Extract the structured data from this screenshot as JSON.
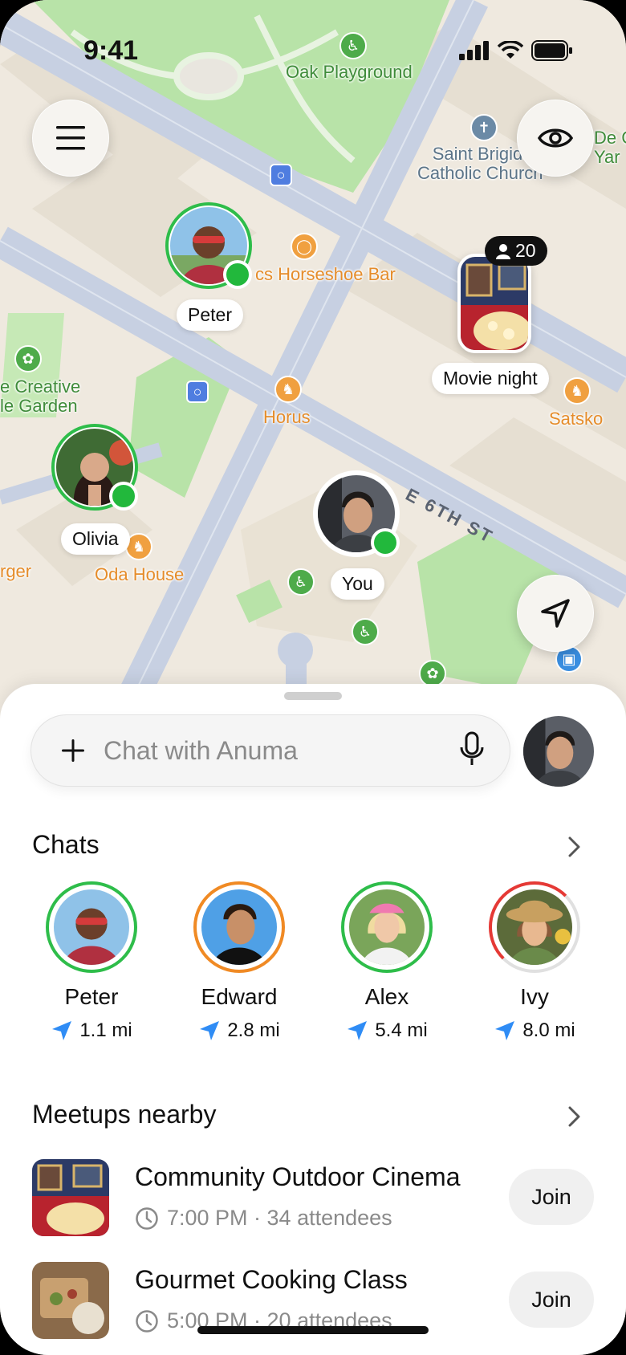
{
  "status": {
    "time": "9:41"
  },
  "map": {
    "labels": {
      "oak_playground": "Oak Playground",
      "church": "Saint Brigid\nCatholic Church",
      "de_co": "De C\nYar",
      "horseshoe": "cs Horseshoe Bar",
      "creative_garden": "e Creative\nle Garden",
      "horus": "Horus",
      "satsko": "Satsko",
      "oda_house": "Oda House",
      "burger": "rger",
      "street": "E 6TH ST"
    },
    "markers": {
      "peter": "Peter",
      "olivia": "Olivia",
      "you": "You",
      "movie_night": "Movie night",
      "movie_night_count": "20"
    }
  },
  "sheet": {
    "chat_placeholder": "Chat with Anuma",
    "chats_title": "Chats",
    "chats": [
      {
        "name": "Peter",
        "distance": "1.1 mi",
        "ring": "#2ebd4a"
      },
      {
        "name": "Edward",
        "distance": "2.8 mi",
        "ring": "#f08a24"
      },
      {
        "name": "Alex",
        "distance": "5.4 mi",
        "ring": "#2ebd4a"
      },
      {
        "name": "Ivy",
        "distance": "8.0 mi",
        "ring": "#e53935"
      }
    ],
    "meetups_title": "Meetups nearby",
    "meetups": [
      {
        "title": "Community Outdoor Cinema",
        "meta": "7:00 PM · 34 attendees",
        "action": "Join"
      },
      {
        "title": "Gourmet Cooking Class",
        "meta": "5:00 PM · 20 attendees",
        "action": "Join"
      }
    ]
  },
  "colors": {
    "online": "#22b83c",
    "accent_blue": "#2f8cf5",
    "map_bg": "#efe9df",
    "park": "#b8e3a8",
    "road": "#c5cfe0"
  }
}
